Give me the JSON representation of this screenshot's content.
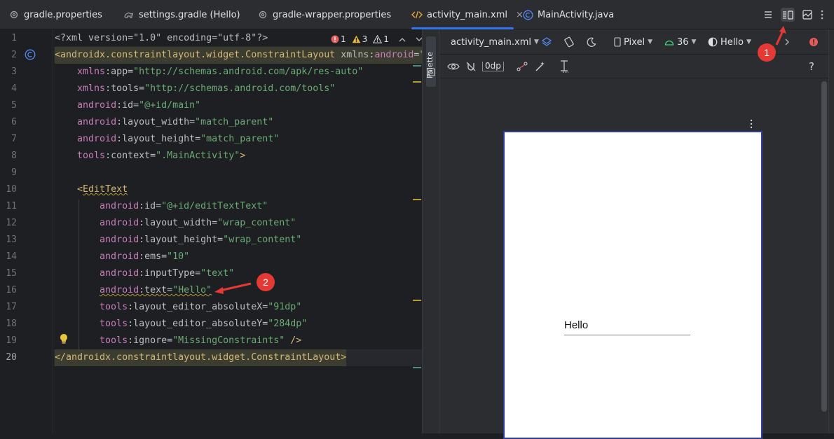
{
  "tabs": [
    {
      "label": "gradle.properties",
      "icon": "gear-icon"
    },
    {
      "label": "settings.gradle (Hello)",
      "icon": "gradle-icon"
    },
    {
      "label": "gradle-wrapper.properties",
      "icon": "gear-icon"
    },
    {
      "label": "activity_main.xml",
      "icon": "xml-icon",
      "active": true,
      "close": "×"
    },
    {
      "label": "MainActivity.java",
      "icon": "class-icon"
    }
  ],
  "view_modes": [
    "code-view-icon",
    "split-view-icon",
    "design-view-icon"
  ],
  "editor": {
    "line_numbers": [
      "1",
      "2",
      "3",
      "4",
      "5",
      "6",
      "7",
      "8",
      "9",
      "10",
      "11",
      "12",
      "13",
      "14",
      "15",
      "16",
      "17",
      "18",
      "19",
      "20"
    ],
    "inspections": {
      "errors": "1",
      "warnings": "3",
      "weak_warnings": "1"
    },
    "lines": [
      "<?xml version=\"1.0\" encoding=\"utf-8\"?>",
      "<androidx.constraintlayout.widget.ConstraintLayout xmlns:android=\"",
      "    xmlns:app=\"http://schemas.android.com/apk/res-auto\"",
      "    xmlns:tools=\"http://schemas.android.com/tools\"",
      "    android:id=\"@+id/main\"",
      "    android:layout_width=\"match_parent\"",
      "    android:layout_height=\"match_parent\"",
      "    tools:context=\".MainActivity\">",
      "",
      "    <EditText",
      "        android:id=\"@+id/editTextText\"",
      "        android:layout_width=\"wrap_content\"",
      "        android:layout_height=\"wrap_content\"",
      "        android:ems=\"10\"",
      "        android:inputType=\"text\"",
      "        android:text=\"Hello\"",
      "        tools:layout_editor_absoluteX=\"91dp\"",
      "        tools:layout_editor_absoluteY=\"284dp\"",
      "        tools:ignore=\"MissingConstraints\" />",
      "</androidx.constraintlayout.widget.ConstraintLayout>"
    ]
  },
  "palette": {
    "label": "Palette"
  },
  "design_toolbar": {
    "file": "activity_main.xml",
    "device": "Pixel",
    "api": "36",
    "theme": "Hello",
    "dp": "0dp",
    "help": "?"
  },
  "preview": {
    "edittext_text": "Hello"
  },
  "annotations": [
    "1",
    "2"
  ],
  "colors": {
    "accent": "#3574f0",
    "annotation": "#e53935",
    "background": "#1e1f22",
    "panel": "#2b2d30"
  }
}
